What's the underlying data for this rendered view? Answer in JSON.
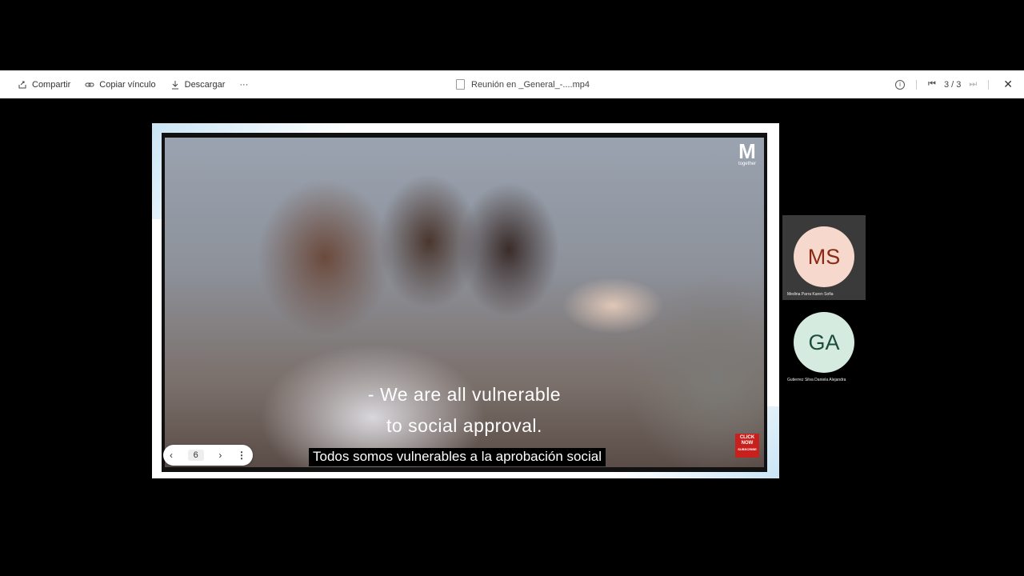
{
  "toolbar": {
    "share_label": "Compartir",
    "copy_link_label": "Copiar vínculo",
    "download_label": "Descargar",
    "more_label": "···",
    "file_name": "Reunión en _General_-....mp4",
    "pager": "3 / 3"
  },
  "slide": {
    "brand_logo": "M",
    "brand_tagline": "together",
    "caption_line1": "- We are all vulnerable",
    "caption_line2": "to social approval.",
    "subtitle": "Todos somos vulnerables  a la aprobación social",
    "badge_text": "CLICK NOW",
    "badge_subtext": "SUBSCRIBE",
    "page_number": "6"
  },
  "participants": [
    {
      "initials": "MS",
      "name": "Medina Parra Karen Sofia",
      "avatar_color": "#f6d8cc",
      "text_color": "#8a2a14",
      "active": true
    },
    {
      "initials": "GA",
      "name": "Gutierrez Silva Daniela Alejandra",
      "avatar_color": "#d5ebe0",
      "text_color": "#1d4d3a",
      "active": false
    }
  ],
  "colors": {
    "toolbar_bg": "#ffffff",
    "page_bg": "#000000",
    "slide_accent": "#c9e4f5"
  }
}
